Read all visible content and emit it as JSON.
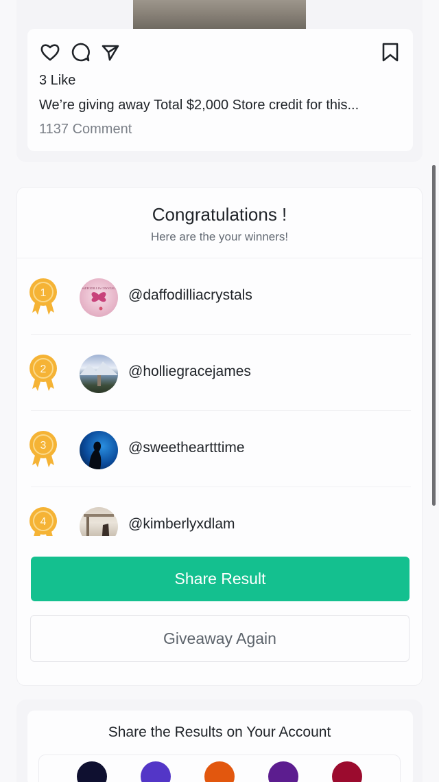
{
  "post": {
    "likes": "3 Like",
    "caption": "We’re giving away Total $2,000 Store credit for this...",
    "comments": "1137 Comment",
    "icons": [
      "heart-icon",
      "comment-icon",
      "send-icon",
      "bookmark-icon"
    ]
  },
  "winners": {
    "title": "Congratulations !",
    "subtitle": "Here are the your winners!",
    "items": [
      {
        "rank": "1",
        "username": "@daffodilliacrystals",
        "avatar_text": "DAFFODILLIA CRYSTALS"
      },
      {
        "rank": "2",
        "username": "@holliegracejames"
      },
      {
        "rank": "3",
        "username": "@sweetheartttime"
      },
      {
        "rank": "4",
        "username": "@kimberlyxdlam"
      }
    ],
    "share_label": "Share Result",
    "again_label": "Giveaway Again"
  },
  "share_account": {
    "title": "Share the Results on Your Account",
    "swatches": [
      "#0f1030",
      "#5336c7",
      "#e2570e",
      "#5c1d8f",
      "#9b0b2e"
    ]
  },
  "colors": {
    "accent": "#14c08f",
    "medal": "#f5b335"
  }
}
